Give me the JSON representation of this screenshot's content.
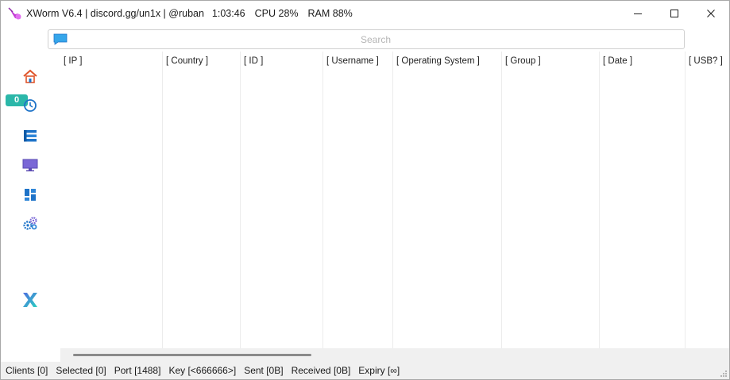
{
  "titlebar": {
    "app_name": "XWorm V6.4 | discord.gg/un1x | @ruban",
    "uptime": "1:03:46",
    "cpu": "CPU 28%",
    "ram": "RAM 88%"
  },
  "window_controls": {
    "minimize_icon": "minimize-icon",
    "maximize_icon": "maximize-icon",
    "close_icon": "close-icon"
  },
  "search": {
    "placeholder": "Search",
    "value": "",
    "icon": "chat-bubble-icon"
  },
  "sidebar": {
    "items": [
      {
        "name": "home",
        "icon": "home-icon"
      },
      {
        "name": "history",
        "icon": "clock-history-icon",
        "badge": "0",
        "badge_color": "#2bb7a9"
      },
      {
        "name": "list",
        "icon": "list-stack-icon"
      },
      {
        "name": "monitor",
        "icon": "monitor-icon"
      },
      {
        "name": "dashboard",
        "icon": "dashboard-icon"
      },
      {
        "name": "settings",
        "icon": "gears-icon"
      }
    ],
    "brand_icon": "x-logo-icon"
  },
  "table": {
    "columns": [
      "[ IP ]",
      "[ Country ]",
      "[ ID ]",
      "[ Username ]",
      "[ Operating System ]",
      "[ Group ]",
      "[ Date ]",
      "[ USB? ]"
    ],
    "rows": []
  },
  "statusbar": {
    "clients": "Clients [0]",
    "selected": "Selected [0]",
    "port": "Port [1488]",
    "key": "Key [<666666>]",
    "sent": "Sent [0B]",
    "received": "Received [0B]",
    "expiry": "Expiry [∞]"
  },
  "colors": {
    "accent": "#2bb7a9",
    "icon_blue": "#1e73c8",
    "home_orange": "#e0552b",
    "monitor_purple": "#7a67d6"
  }
}
